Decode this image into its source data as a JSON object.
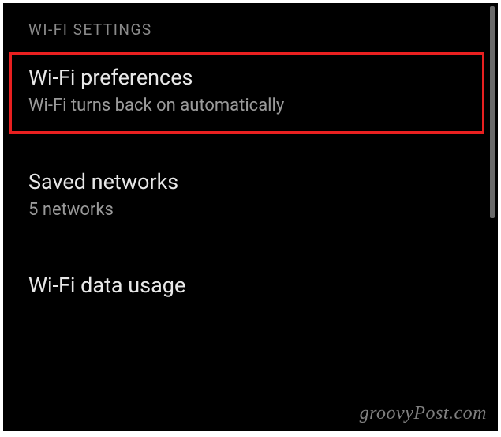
{
  "section_header": "WI-FI SETTINGS",
  "items": [
    {
      "title": "Wi-Fi preferences",
      "subtitle": "Wi-Fi turns back on automatically"
    },
    {
      "title": "Saved networks",
      "subtitle": "5 networks"
    },
    {
      "title": "Wi-Fi data usage",
      "subtitle": ""
    }
  ],
  "watermark": "groovyPost.com"
}
